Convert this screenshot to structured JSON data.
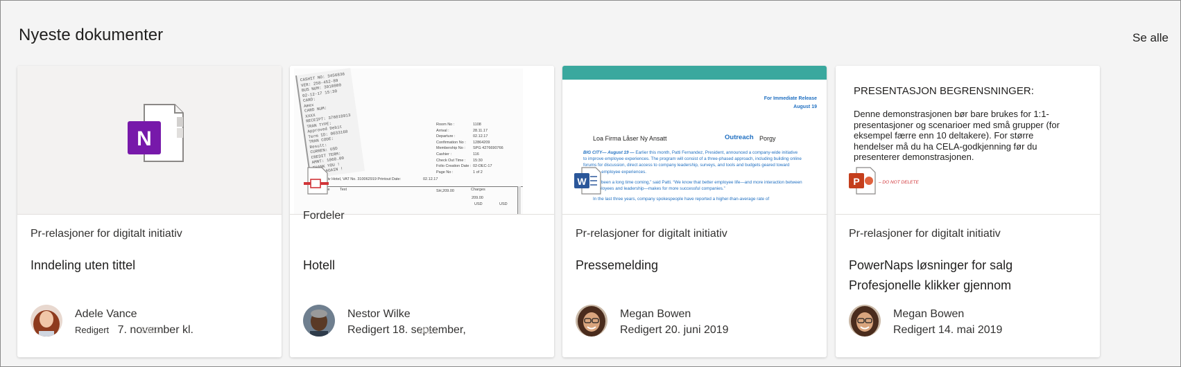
{
  "header": {
    "title": "Nyeste dokumenter",
    "see_all": "Se alle"
  },
  "cards": [
    {
      "location": "Pr-relasjoner for digitalt initiativ",
      "name": "Inndeling uten tittel",
      "author": "Adele Vance",
      "edited_prefix": "Redigert",
      "edited": "7. november kl.",
      "ghost": "2021",
      "app": "OneNote",
      "app_letter": "N",
      "app_color": "#7719aa"
    },
    {
      "location": "Fordeler",
      "name": "Hotell",
      "author": "Nestor Wilke",
      "edited": "Redigert 18. september,",
      "ghost": "2021",
      "app": "PDF",
      "receipt": {
        "lines": [
          "CASHIT NO: 3456836",
          "VER: 258-452-89",
          "BUS NUM: 3910800",
          "02-12-17    15:30",
          "CARD:",
          "Amex",
          "CARD NUM:",
          "XXXX",
          "RECEIPT: 376018913",
          "TRAN TYPE:",
          "Approved Debit",
          "Term ID: 0033168",
          "TRAN CODE:",
          "Result:",
          "CURREN: USD",
          "CREDIT TERM:",
          "AMNT:       1068.00",
          "THANK YOU !",
          "COME AGAIN !"
        ],
        "table_left": [
          "Room No :",
          "Arrival :",
          "Departure :",
          "Confirmation No :",
          "Membership No :",
          "Cashier :",
          "Check Out Time :",
          "Folio Creation Date :",
          "Page No :"
        ],
        "table_right": [
          "1108",
          "28.11.17",
          "02.12.17",
          "12864209",
          "SPG   4276690766",
          "116",
          "15:30",
          "02-DEC-17",
          "1 of 2"
        ],
        "hotel_line": "Tel Aviv Hotel,   VAT No. 310062919    Printout Date:",
        "printout_date": "02.12.17",
        "date_header": "Date",
        "text_header": "Text",
        "amount": "SH,209.00",
        "charges": "Charges",
        "charges_value": "209.00",
        "usd1": "USD",
        "usd2": "USD"
      }
    },
    {
      "location": "Pr-relasjoner for digitalt initiativ",
      "name": "Pressemelding",
      "author": "Megan Bowen",
      "edited": "Redigert 20. juni 2019",
      "app": "Word",
      "app_letter": "W",
      "app_color": "#2b579a",
      "press": {
        "release": "For Immediate Release",
        "date": "August 19",
        "headline_left": "Loa Firma Låser Ny Ansatt",
        "headline_mid": "Outreach",
        "headline_right": "Porgy",
        "p1_lead": "BIG CITY— August 19 —",
        "p1": " Earlier this month, Patti Fernandez, President, announced a company-wide initiative to improve employee experiences. The program will consist of a three-phased approach, including building online forums for discussion, direct access to company leadership, surveys, and tools and budgets geared toward bettering employee experiences.",
        "p2": "has been a long time coming,” said Patti. “We know that better employee life—and more interaction between employees and leadership—makes for more successful companies.”",
        "p3": "In the last three years, company spokespeople have reported a higher-than-average rate of"
      }
    },
    {
      "location": "Pr-relasjoner for digitalt initiativ",
      "name_line1": "PowerNaps løsninger for salg",
      "name_line2": "Profesjonelle klikker gjennom",
      "author": "Megan Bowen",
      "edited": "Redigert 14. mai 2019",
      "app": "PowerPoint",
      "app_letter": "P",
      "app_color": "#c43e1c",
      "slide": {
        "heading_left": "PRESENTASJON",
        "heading_right": "BEGRENSNINGER:",
        "body": "Denne demonstrasjonen bør bare brukes for 1:1-presentasjoner og scenarioer med små grupper (for eksempel færre enn 10 deltakere). For større hendelser må du ha CELA-godkjenning før du presenterer demonstrasjonen.",
        "note": "– DO NOT DELETE"
      }
    }
  ],
  "colors": {
    "accent_teal": "#3aa89e",
    "press_blue": "#1f6fc1"
  }
}
